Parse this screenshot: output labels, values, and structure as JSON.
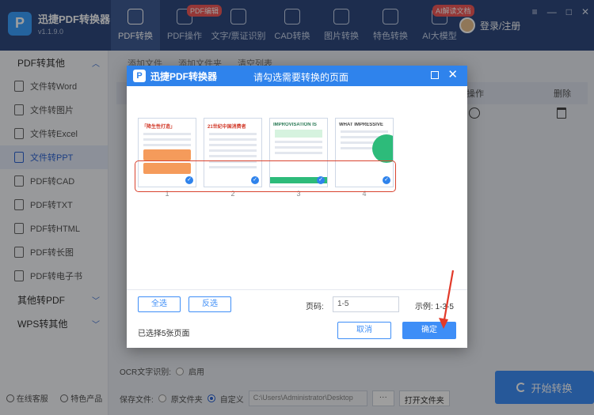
{
  "app": {
    "name": "迅捷PDF转换器",
    "version": "v1.1.9.0",
    "logo_char": "P"
  },
  "nav": [
    {
      "label": "PDF转换",
      "badge": "",
      "active": true
    },
    {
      "label": "PDF操作",
      "badge": "PDF编辑",
      "active": false
    },
    {
      "label": "文字/票证识别",
      "badge": "",
      "active": false
    },
    {
      "label": "CAD转换",
      "badge": "",
      "active": false
    },
    {
      "label": "图片转换",
      "badge": "",
      "active": false
    },
    {
      "label": "特色转换",
      "badge": "",
      "active": false
    },
    {
      "label": "AI大模型",
      "badge": "AI解读文档",
      "active": false
    }
  ],
  "login": {
    "label": "登录/注册"
  },
  "window_controls": {
    "menu": "≡",
    "minimize": "—",
    "maximize": "□",
    "close": "✕"
  },
  "sidebar": {
    "group1": {
      "title": "PDF转其他"
    },
    "items": [
      {
        "label": "文件转Word",
        "icon": "word-icon"
      },
      {
        "label": "文件转图片",
        "icon": "image-icon"
      },
      {
        "label": "文件转Excel",
        "icon": "excel-icon"
      },
      {
        "label": "文件转PPT",
        "icon": "ppt-icon"
      },
      {
        "label": "PDF转CAD",
        "icon": "cad-icon"
      },
      {
        "label": "PDF转TXT",
        "icon": "txt-icon"
      },
      {
        "label": "PDF转HTML",
        "icon": "html-icon"
      },
      {
        "label": "PDF转长图",
        "icon": "longimage-icon"
      },
      {
        "label": "PDF转电子书",
        "icon": "ebook-icon"
      }
    ],
    "group2": {
      "title": "其他转PDF"
    },
    "group3": {
      "title": "WPS转其他"
    },
    "bottom": {
      "service": "在线客服",
      "featured": "特色产品"
    }
  },
  "main": {
    "toolbar": {
      "add_file": "添加文件",
      "add_folder": "添加文件夹",
      "clear": "清空列表"
    },
    "table": {
      "operation": "操作",
      "delete": "删除"
    },
    "ocr": {
      "label": "OCR文字识别:",
      "enable": "启用"
    },
    "save": {
      "label": "保存文件:",
      "original": "原文件夹",
      "custom": "自定义",
      "path": "C:\\Users\\Administrator\\Desktop",
      "browse": "···",
      "open": "打开文件夹"
    },
    "start_button": "开始转换"
  },
  "dialog": {
    "brand": "迅捷PDF转换器",
    "title": "请勾选需要转换的页面",
    "pages": [
      {
        "number": "1",
        "heading": "「降生性打造」"
      },
      {
        "number": "2",
        "heading": "21世纪中国消费者"
      },
      {
        "number": "3",
        "heading": "IMPROVISATION IS"
      },
      {
        "number": "4",
        "heading": "WHAT IMPRESSIVE"
      }
    ],
    "select_all": "全选",
    "invert": "反选",
    "page_range_label": "页码:",
    "page_range_value": "1-5",
    "example": "示例: 1-3-5",
    "selected_count": "已选择5张页面",
    "cancel": "取消",
    "confirm": "确定"
  }
}
